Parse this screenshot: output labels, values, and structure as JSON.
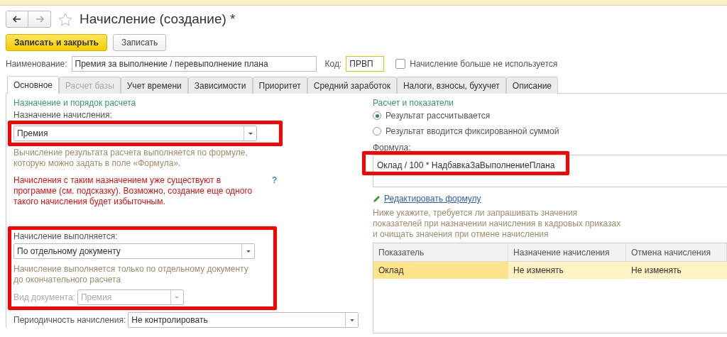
{
  "window": {
    "title": "Начисление (создание) *"
  },
  "toolbar": {
    "buttons": [
      {
        "label": "Записать и закрыть",
        "kind": "primary"
      },
      {
        "label": "Записать",
        "kind": "default"
      }
    ]
  },
  "header": {
    "name_label": "Наименование:",
    "name_value": "Премия за выполнение / перевыполнение плана",
    "code_label": "Код:",
    "code_value": "ПРВП",
    "unused": {
      "label": "Начисление больше не используется",
      "checked": false
    }
  },
  "tabs": [
    {
      "label": "Основное",
      "selected": true,
      "disabled": false
    },
    {
      "label": "Расчет базы",
      "selected": false,
      "disabled": true
    },
    {
      "label": "Учет времени",
      "selected": false,
      "disabled": false
    },
    {
      "label": "Зависимости",
      "selected": false,
      "disabled": false
    },
    {
      "label": "Приоритет",
      "selected": false,
      "disabled": false
    },
    {
      "label": "Средний заработок",
      "selected": false,
      "disabled": false
    },
    {
      "label": "Налоги, взносы, бухучет",
      "selected": false,
      "disabled": false
    },
    {
      "label": "Описание",
      "selected": false,
      "disabled": false
    }
  ],
  "left": {
    "section_title": "Назначение и порядок расчета",
    "purpose": {
      "label": "Назначение начисления:",
      "value": "Премия"
    },
    "purpose_hint": "Вычисление результата расчета выполняется по формуле, которую можно задать в поле «Формула».",
    "warning": "Начисления с таким назначением уже существуют в программе (см. подсказку). Возможно, создание еще одного такого начисления будет избыточным.",
    "help": "?",
    "execution": {
      "label": "Начисление выполняется:",
      "value": "По отдельному документу"
    },
    "execution_hint": "Начисление выполняется только по отдельному документу до окончательного расчета",
    "doc_type": {
      "label": "Вид документа:",
      "value": "Премия",
      "disabled": true
    },
    "periodicity": {
      "label": "Периодичность начисления:",
      "value": "Не контролировать"
    }
  },
  "right": {
    "section_title": "Расчет и показатели",
    "result_options": [
      {
        "label": "Результат рассчитывается",
        "selected": true
      },
      {
        "label": "Результат вводится фиксированной суммой",
        "selected": false
      }
    ],
    "formula_label": "Формула:",
    "formula": "Оклад / 100 * НадбавкаЗаВыполнениеПлана",
    "edit_link": "Редактировать формулу",
    "indicators_hint": "Ниже укажите, требуется ли запрашивать значения показателей при назначении начисления в кадровых приказах и очищать значения при отмене начисления",
    "table": {
      "columns": [
        "Показатель",
        "Назначение начисления",
        "Отмена начисления"
      ],
      "rows": [
        {
          "cells": [
            "Оклад",
            "Не изменять",
            "Не изменять"
          ],
          "selected": true
        }
      ]
    }
  }
}
